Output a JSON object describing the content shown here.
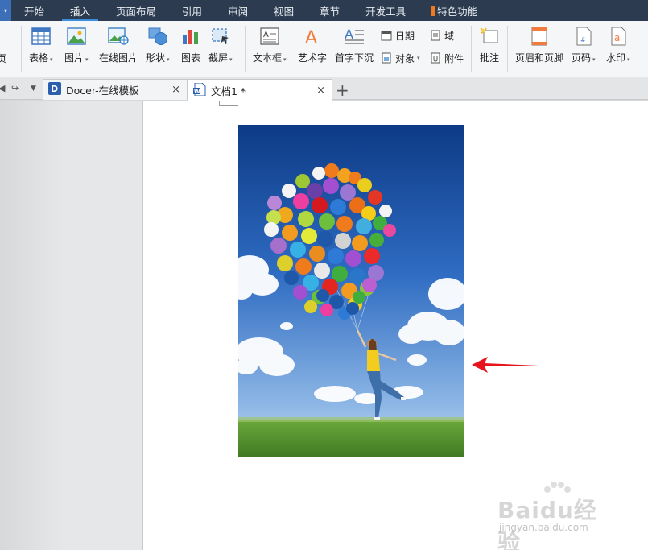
{
  "menubar": {
    "tabs": [
      {
        "label": "开始"
      },
      {
        "label": "插入"
      },
      {
        "label": "页面布局"
      },
      {
        "label": "引用"
      },
      {
        "label": "审阅"
      },
      {
        "label": "视图"
      },
      {
        "label": "章节"
      },
      {
        "label": "开发工具"
      },
      {
        "label": "特色功能"
      }
    ],
    "active_tab": "插入"
  },
  "ribbon": {
    "left_partial_label": "页",
    "buttons": [
      {
        "label": "表格",
        "icon": "table-icon",
        "has_dropdown": true
      },
      {
        "label": "图片",
        "icon": "picture-icon",
        "has_dropdown": true
      },
      {
        "label": "在线图片",
        "icon": "online-picture-icon",
        "has_dropdown": false
      },
      {
        "label": "形状",
        "icon": "shapes-icon",
        "has_dropdown": true
      },
      {
        "label": "图表",
        "icon": "chart-icon",
        "has_dropdown": false
      },
      {
        "label": "截屏",
        "icon": "screenshot-icon",
        "has_dropdown": true
      },
      {
        "label": "文本框",
        "icon": "textbox-icon",
        "has_dropdown": true
      },
      {
        "label": "艺术字",
        "icon": "wordart-icon",
        "has_dropdown": true
      },
      {
        "label": "首字下沉",
        "icon": "dropcap-icon",
        "has_dropdown": false
      },
      {
        "label": "批注",
        "icon": "comment-icon",
        "has_dropdown": false
      },
      {
        "label": "页眉和页脚",
        "icon": "header-footer-icon",
        "has_dropdown": false
      },
      {
        "label": "页码",
        "icon": "page-number-icon",
        "has_dropdown": true
      },
      {
        "label": "水印",
        "icon": "watermark-icon",
        "has_dropdown": true
      }
    ],
    "small_buttons": [
      {
        "label": "日期",
        "icon": "date-icon"
      },
      {
        "label": "域",
        "icon": "field-icon"
      },
      {
        "label": "对象",
        "icon": "object-icon"
      },
      {
        "label": "附件",
        "icon": "attachment-icon"
      }
    ]
  },
  "tabs": {
    "docs": [
      {
        "title": "Docer-在线模板",
        "icon": "docer-icon"
      },
      {
        "title": "文档1 *",
        "icon": "wps-doc-icon"
      }
    ],
    "close_glyph": "×",
    "new_tab_glyph": "+"
  },
  "watermark": {
    "brand": "Baidu经验",
    "url": "jingyan.baidu.com"
  },
  "colors": {
    "menubar_bg": "#2c3b4f",
    "accent": "#3c8ddb",
    "arrow": "#e8141c"
  }
}
